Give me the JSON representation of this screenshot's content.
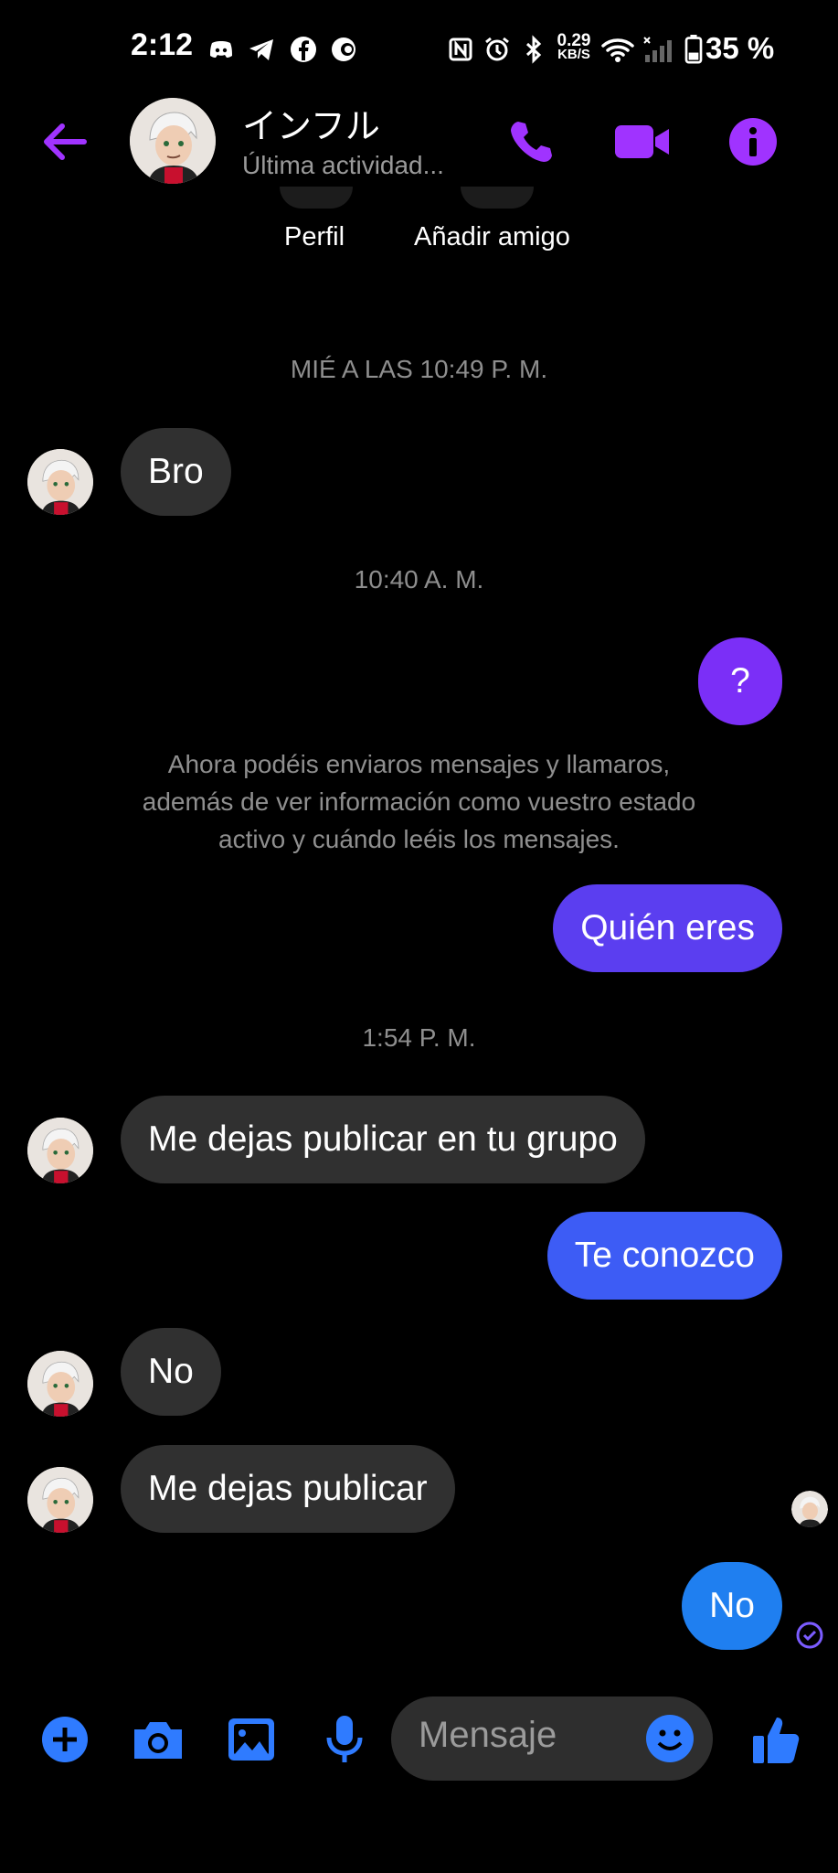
{
  "status_bar": {
    "time": "2:12",
    "net_speed_value": "0.29",
    "net_speed_unit": "KB/S",
    "battery": "35 %"
  },
  "header": {
    "title": "インフル",
    "subtitle": "Última actividad..."
  },
  "profile_actions": {
    "profile_label": "Perfil",
    "add_friend_label": "Añadir amigo"
  },
  "conversation": {
    "separators": [
      "MIÉ A LAS 10:49 P. M.",
      "10:40 A. M.",
      "1:54 P. M."
    ],
    "notice": "Ahora podéis enviaros mensajes y llamaros, además de ver información como vuestro estado activo y cuándo leéis los mensajes.",
    "messages": [
      {
        "from": "them",
        "text": "Bro"
      },
      {
        "from": "me",
        "text": "?"
      },
      {
        "from": "me",
        "text": "Quién eres"
      },
      {
        "from": "them",
        "text": "Me dejas publicar en tu grupo"
      },
      {
        "from": "me",
        "text": "Te conozco"
      },
      {
        "from": "them",
        "text": "No"
      },
      {
        "from": "them",
        "text": "Me dejas publicar"
      },
      {
        "from": "me",
        "text": "No"
      }
    ]
  },
  "composer": {
    "placeholder": "Mensaje"
  },
  "colors": {
    "accent_purple": "#a033ff",
    "bubble_purple": "#7b2ff7",
    "bubble_indigo": "#5b3ef0",
    "bubble_blue_mid": "#3d5cf5",
    "bubble_blue": "#1f7ff0",
    "composer_blue": "#2f7bff",
    "incoming_bubble": "#303030"
  },
  "icons": [
    "back-arrow-icon",
    "phone-icon",
    "video-camera-icon",
    "info-icon",
    "plus-icon",
    "camera-icon",
    "gallery-icon",
    "microphone-icon",
    "emoji-icon",
    "thumbs-up-icon",
    "read-receipt-icon"
  ]
}
